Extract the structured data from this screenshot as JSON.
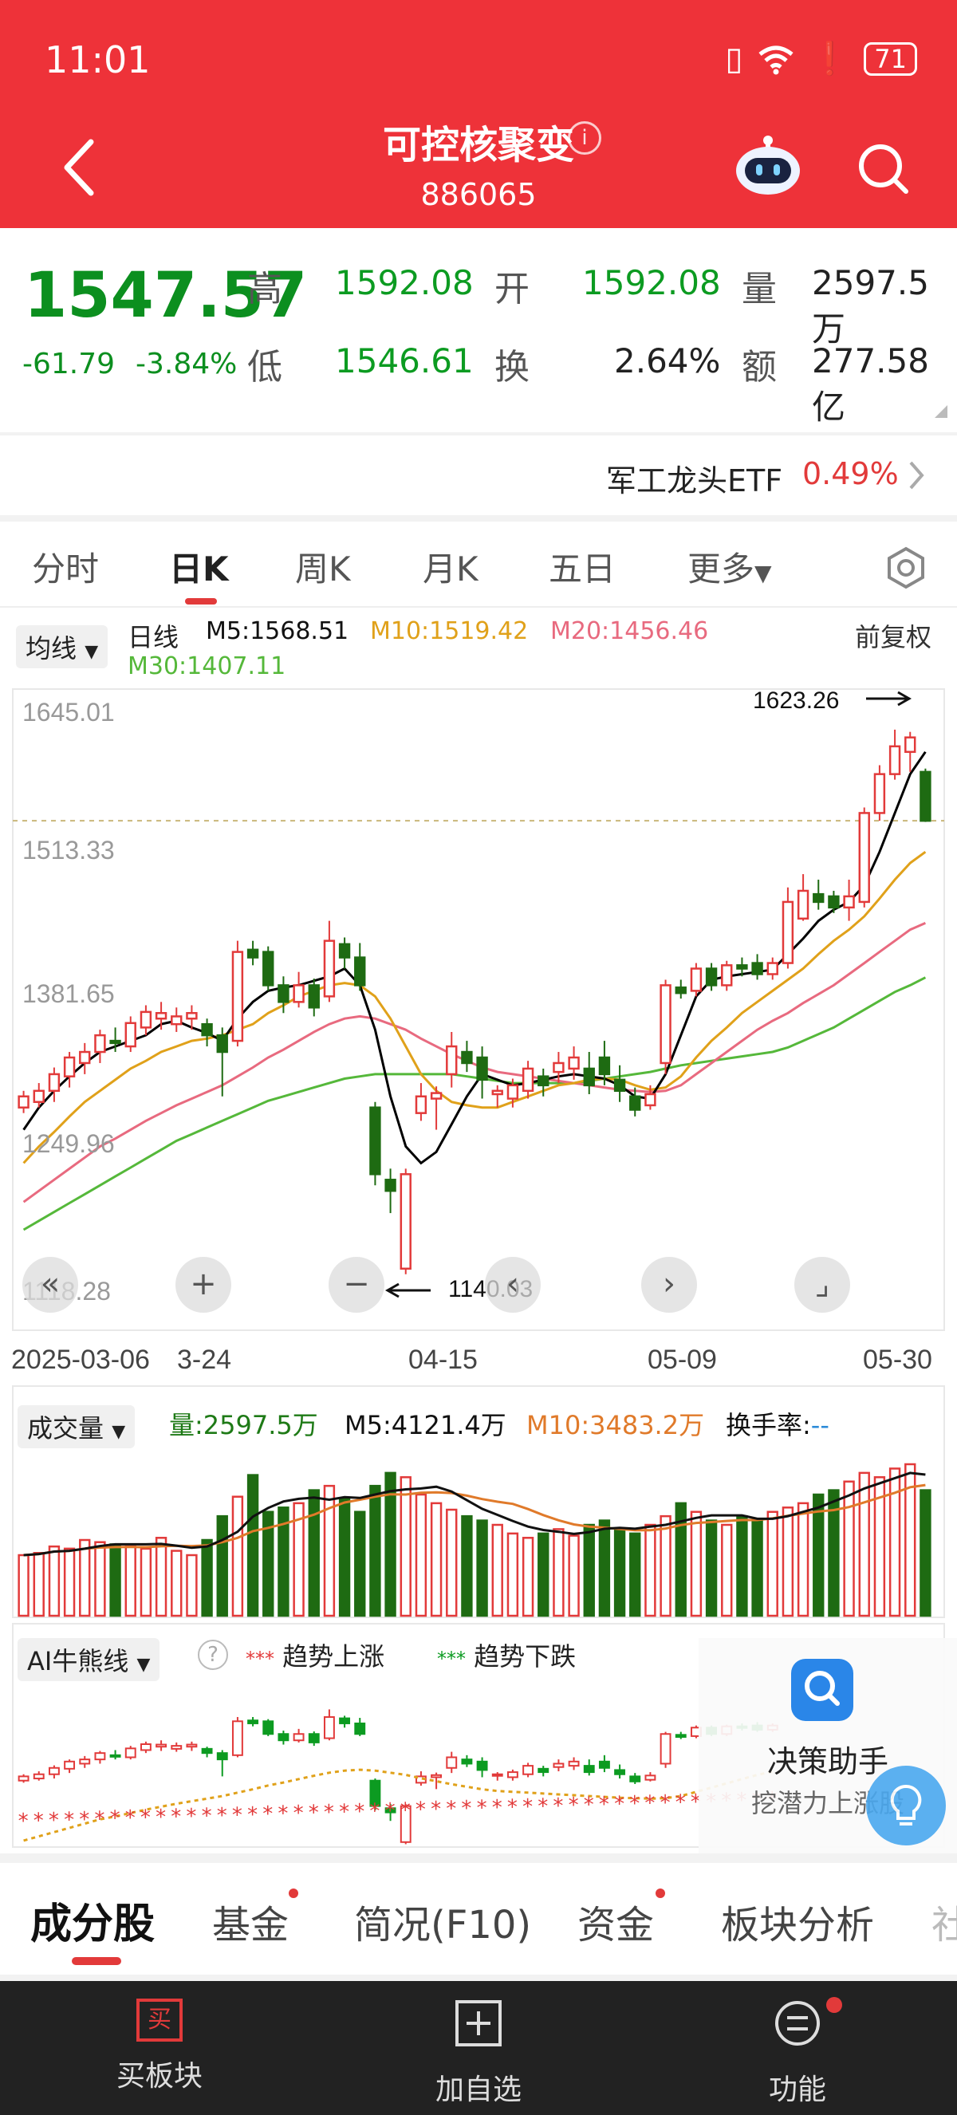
{
  "status": {
    "time": "11:01",
    "battery": "71"
  },
  "header": {
    "title": "可控核聚变",
    "code": "886065",
    "info_glyph": "i"
  },
  "quote": {
    "price": "1547.57",
    "change": "-61.79",
    "change_pct": "-3.84%",
    "high_label": "高",
    "high": "1592.08",
    "low_label": "低",
    "low": "1546.61",
    "open_label": "开",
    "open": "1592.08",
    "turnover_label": "换",
    "turnover": "2.64%",
    "volume_label": "量",
    "volume": "2597.5万",
    "amount_label": "额",
    "amount": "277.58亿"
  },
  "etf": {
    "name": "军工龙头ETF",
    "pct": "0.49%"
  },
  "ktabs": {
    "t1": "分时",
    "t2": "日K",
    "t3": "周K",
    "t4": "月K",
    "t5": "五日",
    "t6": "更多"
  },
  "ma": {
    "selector": "均线",
    "period": "日线",
    "m5": "M5:1568.51",
    "m10": "M10:1519.42",
    "m20": "M20:1456.46",
    "m30": "M30:1407.11",
    "adjust": "前复权"
  },
  "price_axis": {
    "p1": "1645.01",
    "p2": "1513.33",
    "p3": "1381.65",
    "p4": "1249.96",
    "p5": "1118.28"
  },
  "annotations": {
    "max": "1623.26",
    "min": "1140.03"
  },
  "dates": {
    "d1": "2025-03-06",
    "d2": "3-24",
    "d3": "04-15",
    "d4": "05-09",
    "d5": "05-30"
  },
  "volume": {
    "selector": "成交量",
    "vol": "量:2597.5万",
    "m5": "M5:4121.4万",
    "m10": "M10:3483.2万",
    "turnover": "换手率:",
    "turnover_val": "--"
  },
  "ai": {
    "selector": "AI牛熊线",
    "up_marks": "***",
    "up": "趋势上涨",
    "down_marks": "***",
    "down": "趋势下跌"
  },
  "assistant": {
    "title": "决策助手",
    "subtitle": "挖潜力上涨股"
  },
  "bottom_tabs": {
    "b1": "成分股",
    "b2": "基金",
    "b3": "简况(F10)",
    "b4": "资金",
    "b5": "板块分析",
    "b6": "社"
  },
  "nav": {
    "n1_icon_text": "买",
    "n1": "买板块",
    "n2": "加自选",
    "n3": "功能"
  },
  "colors": {
    "up": "#e23a3a",
    "down": "#1e6b12",
    "m5": "#000000",
    "m10": "#e0a11a",
    "m20": "#e86a7f",
    "m30": "#55b83a"
  },
  "chart_data": {
    "type": "candlestick",
    "ylim": [
      1118.28,
      1645.01
    ],
    "annotation_high": 1623.26,
    "annotation_low": 1140.03,
    "candles": [
      [
        1290,
        1300,
        1285,
        1305
      ],
      [
        1295,
        1305,
        1290,
        1312
      ],
      [
        1305,
        1320,
        1295,
        1326
      ],
      [
        1318,
        1335,
        1308,
        1340
      ],
      [
        1330,
        1340,
        1320,
        1348
      ],
      [
        1340,
        1355,
        1330,
        1360
      ],
      [
        1350,
        1348,
        1340,
        1362
      ],
      [
        1345,
        1366,
        1340,
        1372
      ],
      [
        1362,
        1376,
        1355,
        1382
      ],
      [
        1370,
        1375,
        1360,
        1385
      ],
      [
        1365,
        1372,
        1358,
        1380
      ],
      [
        1370,
        1375,
        1360,
        1382
      ],
      [
        1365,
        1355,
        1345,
        1370
      ],
      [
        1355,
        1340,
        1300,
        1362
      ],
      [
        1350,
        1430,
        1345,
        1440
      ],
      [
        1432,
        1425,
        1418,
        1440
      ],
      [
        1430,
        1400,
        1395,
        1435
      ],
      [
        1400,
        1385,
        1375,
        1408
      ],
      [
        1385,
        1400,
        1380,
        1412
      ],
      [
        1400,
        1380,
        1372,
        1406
      ],
      [
        1390,
        1440,
        1385,
        1458
      ],
      [
        1437,
        1425,
        1415,
        1443
      ],
      [
        1425,
        1400,
        1395,
        1438
      ],
      [
        1290,
        1230,
        1220,
        1295
      ],
      [
        1225,
        1215,
        1195,
        1235
      ],
      [
        1145,
        1230,
        1140,
        1235
      ],
      [
        1285,
        1300,
        1278,
        1312
      ],
      [
        1298,
        1303,
        1270,
        1309
      ],
      [
        1320,
        1345,
        1308,
        1358
      ],
      [
        1340,
        1330,
        1322,
        1350
      ],
      [
        1335,
        1315,
        1298,
        1345
      ],
      [
        1302,
        1305,
        1290,
        1310
      ],
      [
        1298,
        1310,
        1290,
        1316
      ],
      [
        1305,
        1325,
        1298,
        1332
      ],
      [
        1318,
        1310,
        1300,
        1325
      ],
      [
        1322,
        1330,
        1312,
        1340
      ],
      [
        1325,
        1335,
        1315,
        1345
      ],
      [
        1325,
        1310,
        1302,
        1340
      ],
      [
        1335,
        1320,
        1310,
        1350
      ],
      [
        1315,
        1305,
        1295,
        1328
      ],
      [
        1300,
        1288,
        1282,
        1308
      ],
      [
        1292,
        1302,
        1288,
        1310
      ],
      [
        1330,
        1400,
        1320,
        1405
      ],
      [
        1398,
        1393,
        1388,
        1405
      ],
      [
        1395,
        1415,
        1390,
        1420
      ],
      [
        1415,
        1400,
        1395,
        1420
      ],
      [
        1400,
        1418,
        1395,
        1422
      ],
      [
        1418,
        1415,
        1408,
        1425
      ],
      [
        1420,
        1410,
        1405,
        1428
      ],
      [
        1410,
        1420,
        1405,
        1425
      ],
      [
        1420,
        1475,
        1415,
        1488
      ],
      [
        1460,
        1485,
        1458,
        1500
      ],
      [
        1482,
        1475,
        1468,
        1495
      ],
      [
        1480,
        1470,
        1465,
        1485
      ],
      [
        1470,
        1480,
        1458,
        1495
      ],
      [
        1475,
        1555,
        1470,
        1560
      ],
      [
        1555,
        1590,
        1548,
        1598
      ],
      [
        1590,
        1615,
        1585,
        1630
      ],
      [
        1610,
        1623,
        1592,
        1628
      ],
      [
        1592,
        1548,
        1547,
        1595
      ]
    ],
    "volumes": [
      28,
      29,
      32,
      31,
      35,
      34,
      33,
      32,
      31,
      36,
      30,
      28,
      35,
      46,
      55,
      65,
      48,
      50,
      52,
      58,
      60,
      54,
      48,
      60,
      66,
      64,
      56,
      52,
      49,
      46,
      44,
      42,
      38,
      36,
      38,
      40,
      37,
      42,
      44,
      40,
      38,
      42,
      46,
      52,
      48,
      44,
      42,
      46,
      44,
      48,
      50,
      52,
      56,
      58,
      62,
      66,
      64,
      68,
      70,
      58
    ],
    "m5_line": [
      1270,
      1290,
      1305,
      1318,
      1330,
      1340,
      1345,
      1350,
      1355,
      1365,
      1368,
      1362,
      1357,
      1350,
      1370,
      1385,
      1395,
      1398,
      1400,
      1404,
      1408,
      1415,
      1400,
      1360,
      1300,
      1255,
      1240,
      1250,
      1275,
      1300,
      1320,
      1315,
      1310,
      1312,
      1315,
      1318,
      1320,
      1318,
      1316,
      1310,
      1300,
      1298,
      1320,
      1355,
      1390,
      1405,
      1408,
      1410,
      1412,
      1414,
      1428,
      1442,
      1458,
      1468,
      1475,
      1490,
      1520,
      1555,
      1590,
      1610
    ],
    "m10_line": [
      1240,
      1255,
      1268,
      1282,
      1295,
      1305,
      1315,
      1325,
      1332,
      1340,
      1345,
      1350,
      1352,
      1355,
      1360,
      1365,
      1375,
      1382,
      1390,
      1395,
      1400,
      1402,
      1400,
      1390,
      1370,
      1345,
      1320,
      1305,
      1295,
      1292,
      1290,
      1290,
      1295,
      1300,
      1305,
      1310,
      1312,
      1315,
      1316,
      1315,
      1310,
      1306,
      1308,
      1318,
      1335,
      1350,
      1362,
      1375,
      1385,
      1395,
      1405,
      1415,
      1428,
      1440,
      1450,
      1462,
      1478,
      1495,
      1510,
      1520
    ],
    "m20_line": [
      1205,
      1215,
      1225,
      1235,
      1245,
      1255,
      1262,
      1270,
      1278,
      1285,
      1292,
      1298,
      1304,
      1310,
      1318,
      1326,
      1335,
      1342,
      1350,
      1358,
      1365,
      1370,
      1372,
      1370,
      1365,
      1360,
      1352,
      1345,
      1338,
      1332,
      1326,
      1322,
      1320,
      1318,
      1316,
      1314,
      1312,
      1310,
      1308,
      1306,
      1305,
      1304,
      1305,
      1310,
      1320,
      1330,
      1340,
      1350,
      1360,
      1368,
      1375,
      1384,
      1392,
      1400,
      1410,
      1420,
      1430,
      1440,
      1450,
      1456
    ],
    "m30_line": [
      1180,
      1188,
      1196,
      1204,
      1212,
      1220,
      1228,
      1236,
      1244,
      1252,
      1260,
      1266,
      1272,
      1278,
      1284,
      1290,
      1296,
      1300,
      1304,
      1308,
      1312,
      1316,
      1318,
      1320,
      1320,
      1320,
      1320,
      1320,
      1320,
      1318,
      1316,
      1314,
      1312,
      1312,
      1312,
      1312,
      1312,
      1314,
      1316,
      1318,
      1320,
      1322,
      1325,
      1328,
      1330,
      1332,
      1334,
      1336,
      1338,
      1340,
      1344,
      1350,
      1356,
      1362,
      1370,
      1378,
      1386,
      1394,
      1400,
      1407
    ]
  }
}
